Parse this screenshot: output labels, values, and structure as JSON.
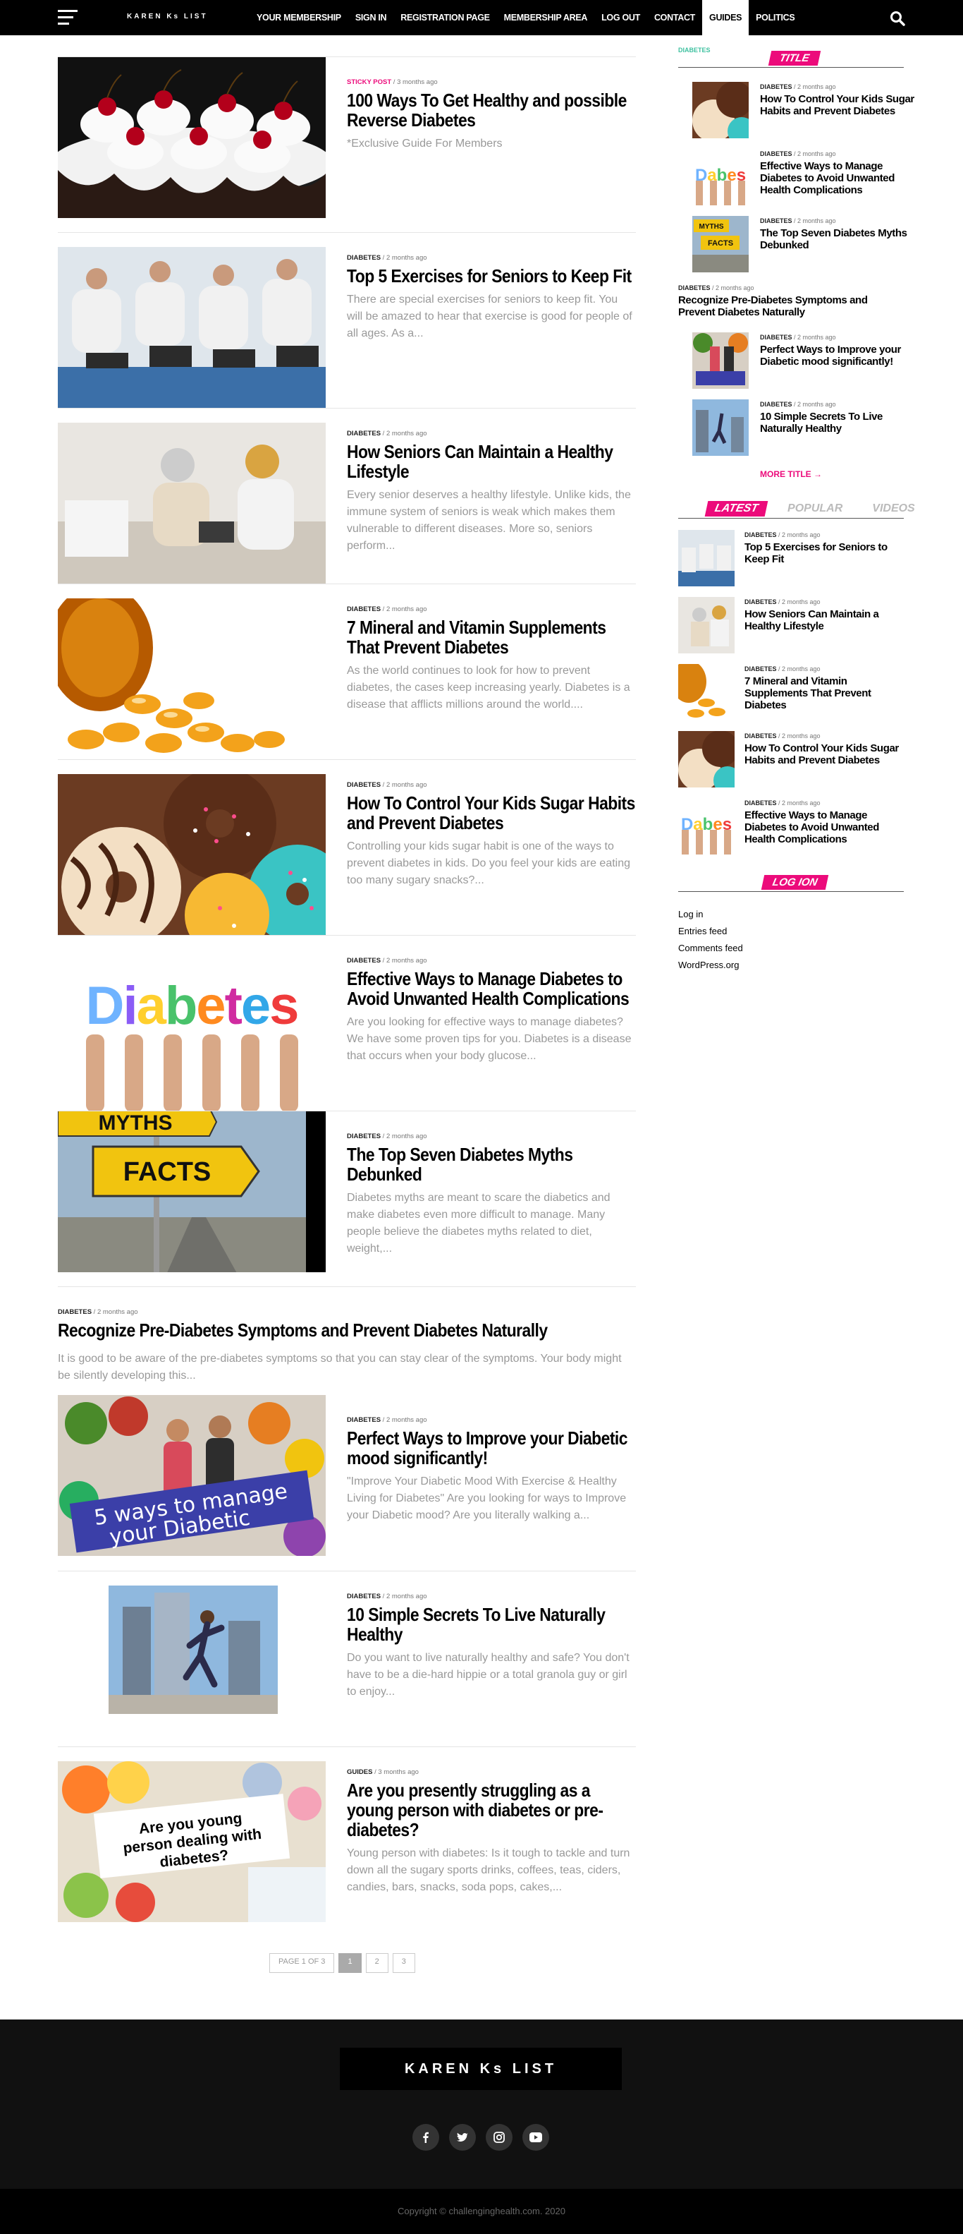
{
  "site": {
    "logo": "KAREN Ks LIST"
  },
  "nav": {
    "items": [
      "YOUR MEMBERSHIP",
      "SIGN IN",
      "REGISTRATION PAGE",
      "MEMBERSHIP AREA",
      "LOG OUT",
      "CONTACT",
      "GUIDES",
      "POLITICS"
    ],
    "active": "GUIDES",
    "menu_icon": "hamburger-icon",
    "search_icon": "search-icon"
  },
  "posts": [
    {
      "cat": "STICKY POST",
      "ago": "3 months ago",
      "title": "100 Ways To Get Healthy and possible Reverse Diabetes",
      "excerpt": "*Exclusive Guide For Members"
    },
    {
      "cat": "DIABETES",
      "ago": "2 months ago",
      "title": "Top 5 Exercises for Seniors to Keep Fit",
      "excerpt": "There are special exercises for seniors to keep fit. You will be amazed to hear that exercise is good for people of all ages. As a..."
    },
    {
      "cat": "DIABETES",
      "ago": "2 months ago",
      "title": "How Seniors Can Maintain a Healthy Lifestyle",
      "excerpt": "Every senior deserves a healthy lifestyle. Unlike kids, the immune system of seniors is weak which makes them vulnerable to different diseases. More so, seniors perform..."
    },
    {
      "cat": "DIABETES",
      "ago": "2 months ago",
      "title": "7 Mineral and Vitamin Supplements That Prevent Diabetes",
      "excerpt": "As the world continues to look for how to prevent diabetes, the cases keep increasing yearly. Diabetes is a disease that afflicts millions around the world...."
    },
    {
      "cat": "DIABETES",
      "ago": "2 months ago",
      "title": "How To Control Your Kids Sugar Habits and Prevent Diabetes",
      "excerpt": "Controlling your kids sugar habit is one of the ways to prevent diabetes in kids. Do you feel your kids are eating too many sugary snacks?..."
    },
    {
      "cat": "DIABETES",
      "ago": "2 months ago",
      "title": "Effective Ways to Manage Diabetes to Avoid Unwanted Health Complications",
      "excerpt": "Are you looking for effective ways to manage diabetes? We have some proven tips for you. Diabetes is a disease that occurs when your body glucose..."
    },
    {
      "cat": "DIABETES",
      "ago": "2 months ago",
      "title": "The Top Seven Diabetes Myths Debunked",
      "excerpt": "Diabetes myths are meant to scare the diabetics and make diabetes even more difficult to manage. Many people believe the diabetes myths related to diet, weight,..."
    },
    {
      "cat": "DIABETES",
      "ago": "2 months ago",
      "title": "Recognize Pre-Diabetes Symptoms and Prevent Diabetes Naturally",
      "excerpt": "It is good to be aware of the pre-diabetes symptoms so that you can stay clear of the symptoms. Your body might be silently developing this..."
    },
    {
      "cat": "DIABETES",
      "ago": "2 months ago",
      "title": "Perfect Ways to Improve your Diabetic mood significantly!",
      "excerpt": "\"Improve Your Diabetic Mood With Exercise & Healthy Living for Diabetes\"     Are you looking for ways to Improve your Diabetic mood? Are you literally walking a..."
    },
    {
      "cat": "DIABETES",
      "ago": "2 months ago",
      "title": "10 Simple Secrets To Live Naturally Healthy",
      "excerpt": "Do you want to live naturally healthy and safe? You don't have to be a die-hard hippie or a total granola guy or girl to enjoy..."
    },
    {
      "cat": "GUIDES",
      "ago": "3 months ago",
      "title": "Are you presently struggling as a young person with diabetes or pre-diabetes?",
      "excerpt": "Young person with diabetes: Is it tough to tackle and turn down all the sugary sports drinks, coffees, teas, ciders, candies, bars, snacks, soda pops, cakes,..."
    }
  ],
  "thumb_text": {
    "myths": "MYTHS",
    "facts": "FACTS",
    "diabetes": "Diabetes",
    "five_ways": "5 ways to manage your Diabetic",
    "young": "Are you young person dealing with diabetes?"
  },
  "pager": {
    "label": "PAGE 1 OF 3",
    "pages": [
      "1",
      "2",
      "3"
    ],
    "current": "1"
  },
  "sidebar": {
    "cat_label": "DIABETES",
    "title_label": "TITLE",
    "title_items": [
      {
        "cat": "DIABETES",
        "ago": "2 months ago",
        "title": "How To Control Your Kids Sugar Habits and Prevent Diabetes"
      },
      {
        "cat": "DIABETES",
        "ago": "2 months ago",
        "title": "Effective Ways to Manage Diabetes to Avoid Unwanted Health Complications"
      },
      {
        "cat": "DIABETES",
        "ago": "2 months ago",
        "title": "The Top Seven Diabetes Myths Debunked"
      },
      {
        "cat": "DIABETES",
        "ago": "2 months ago",
        "title": "Recognize Pre-Diabetes Symptoms and Prevent Diabetes Naturally"
      },
      {
        "cat": "DIABETES",
        "ago": "2 months ago",
        "title": "Perfect Ways to Improve your Diabetic mood significantly!"
      },
      {
        "cat": "DIABETES",
        "ago": "2 months ago",
        "title": "10 Simple Secrets To Live Naturally Healthy"
      }
    ],
    "more_title": "MORE TITLE",
    "tabs": [
      "LATEST",
      "POPULAR",
      "VIDEOS"
    ],
    "latest_items": [
      {
        "cat": "DIABETES",
        "ago": "2 months ago",
        "title": "Top 5 Exercises for Seniors to Keep Fit"
      },
      {
        "cat": "DIABETES",
        "ago": "2 months ago",
        "title": "How Seniors Can Maintain a Healthy Lifestyle"
      },
      {
        "cat": "DIABETES",
        "ago": "2 months ago",
        "title": "7 Mineral and Vitamin Supplements That Prevent Diabetes"
      },
      {
        "cat": "DIABETES",
        "ago": "2 months ago",
        "title": "How To Control Your Kids Sugar Habits and Prevent Diabetes"
      },
      {
        "cat": "DIABETES",
        "ago": "2 months ago",
        "title": "Effective Ways to Manage Diabetes to Avoid Unwanted Health Complications"
      }
    ],
    "login_label": "LOG ION",
    "login_links": [
      "Log in",
      "Entries feed",
      "Comments feed",
      "WordPress.org"
    ]
  },
  "footer": {
    "logo": "KAREN Ks LIST",
    "socials": [
      "facebook-icon",
      "twitter-icon",
      "instagram-icon",
      "youtube-icon"
    ],
    "copyright": "Copyright © challenginghealth.com. 2020"
  },
  "colors": {
    "accent": "#ec0b7b",
    "nav_bg": "#000000",
    "footer_bg": "#111111"
  }
}
